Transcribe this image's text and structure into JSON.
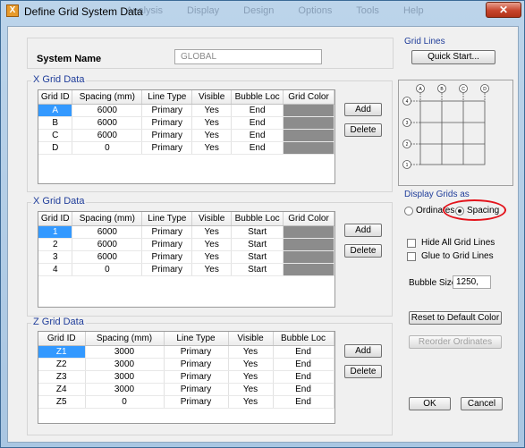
{
  "window": {
    "title": "Define Grid System Data",
    "close": "✕",
    "app_icon": "X",
    "ghost_menu": "Analysis Display Design Options Tools Help"
  },
  "system": {
    "label": "System Name",
    "value": "GLOBAL"
  },
  "grid_lines": {
    "label": "Grid Lines",
    "quick_start": "Quick Start..."
  },
  "x_grid": {
    "title": "X Grid Data",
    "headers": [
      "Grid ID",
      "Spacing (mm)",
      "Line Type",
      "Visible",
      "Bubble Loc",
      "Grid Color"
    ],
    "rows": [
      [
        "A",
        "6000",
        "Primary",
        "Yes",
        "End"
      ],
      [
        "B",
        "6000",
        "Primary",
        "Yes",
        "End"
      ],
      [
        "C",
        "6000",
        "Primary",
        "Yes",
        "End"
      ],
      [
        "D",
        "0",
        "Primary",
        "Yes",
        "End"
      ]
    ],
    "add": "Add",
    "delete": "Delete"
  },
  "y_grid": {
    "title": "X Grid Data",
    "headers": [
      "Grid ID",
      "Spacing (mm)",
      "Line Type",
      "Visible",
      "Bubble Loc",
      "Grid Color"
    ],
    "rows": [
      [
        "1",
        "6000",
        "Primary",
        "Yes",
        "Start"
      ],
      [
        "2",
        "6000",
        "Primary",
        "Yes",
        "Start"
      ],
      [
        "3",
        "6000",
        "Primary",
        "Yes",
        "Start"
      ],
      [
        "4",
        "0",
        "Primary",
        "Yes",
        "Start"
      ]
    ],
    "add": "Add",
    "delete": "Delete"
  },
  "z_grid": {
    "title": "Z Grid Data",
    "headers": [
      "Grid ID",
      "Spacing (mm)",
      "Line Type",
      "Visible",
      "Bubble Loc"
    ],
    "rows": [
      [
        "Z1",
        "3000",
        "Primary",
        "Yes",
        "End"
      ],
      [
        "Z2",
        "3000",
        "Primary",
        "Yes",
        "End"
      ],
      [
        "Z3",
        "3000",
        "Primary",
        "Yes",
        "End"
      ],
      [
        "Z4",
        "3000",
        "Primary",
        "Yes",
        "End"
      ],
      [
        "Z5",
        "0",
        "Primary",
        "Yes",
        "End"
      ]
    ],
    "add": "Add",
    "delete": "Delete"
  },
  "preview": {
    "col_labels": [
      "A",
      "B",
      "C",
      "D"
    ],
    "row_labels": [
      "4",
      "3",
      "2",
      "1"
    ]
  },
  "display": {
    "label": "Display Grids as",
    "ordinates": "Ordinates",
    "spacing": "Spacing",
    "selected": "spacing"
  },
  "options": {
    "hide_all": "Hide All Grid Lines",
    "glue": "Glue to Grid Lines"
  },
  "bubble": {
    "label": "Bubble Size",
    "value": "1250,"
  },
  "buttons": {
    "reset_color": "Reset to Default Color",
    "reorder": "Reorder Ordinates",
    "ok": "OK",
    "cancel": "Cancel"
  },
  "colors": {
    "grid_color": "#8c8c8c",
    "selection": "#3399ff",
    "highlight": "#e3131b",
    "group_title": "#1f3d9a"
  }
}
